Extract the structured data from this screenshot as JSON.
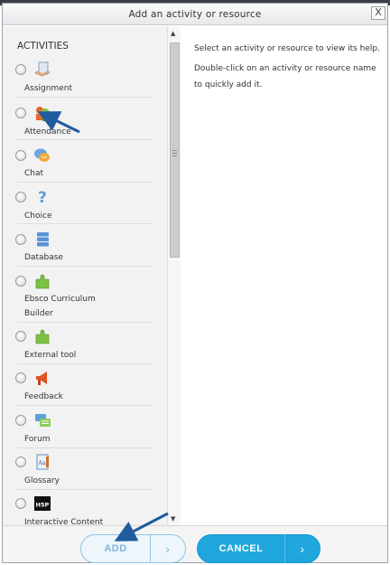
{
  "dialog": {
    "title": "Add an activity or resource",
    "close_label": "X"
  },
  "left_pane": {
    "heading": "ACTIVITIES",
    "items": [
      {
        "label": "Assignment",
        "icon": "assignment-icon"
      },
      {
        "label": "Attendance",
        "icon": "attendance-icon"
      },
      {
        "label": "Chat",
        "icon": "chat-icon"
      },
      {
        "label": "Choice",
        "icon": "choice-icon"
      },
      {
        "label": "Database",
        "icon": "database-icon"
      },
      {
        "label": "Ebsco Curriculum",
        "label2": "Builder",
        "icon": "puzzle-icon"
      },
      {
        "label": "External tool",
        "icon": "puzzle-icon"
      },
      {
        "label": "Feedback",
        "icon": "megaphone-icon"
      },
      {
        "label": "Forum",
        "icon": "forum-icon"
      },
      {
        "label": "Glossary",
        "icon": "glossary-icon"
      },
      {
        "label": "Interactive Content",
        "icon": "h5p-icon"
      }
    ]
  },
  "right_pane": {
    "help_line1": "Select an activity or resource to view its help.",
    "help_line2": "Double-click on an activity or resource name",
    "help_line3": "to quickly add it."
  },
  "footer": {
    "add_label": "ADD",
    "cancel_label": "CANCEL"
  },
  "icons": {
    "h5p_text": "H5P"
  },
  "colors": {
    "cancel_button": "#1ea6dd",
    "add_button_border": "#8fc3e3",
    "annotation_arrow": "#1f5c9e"
  }
}
